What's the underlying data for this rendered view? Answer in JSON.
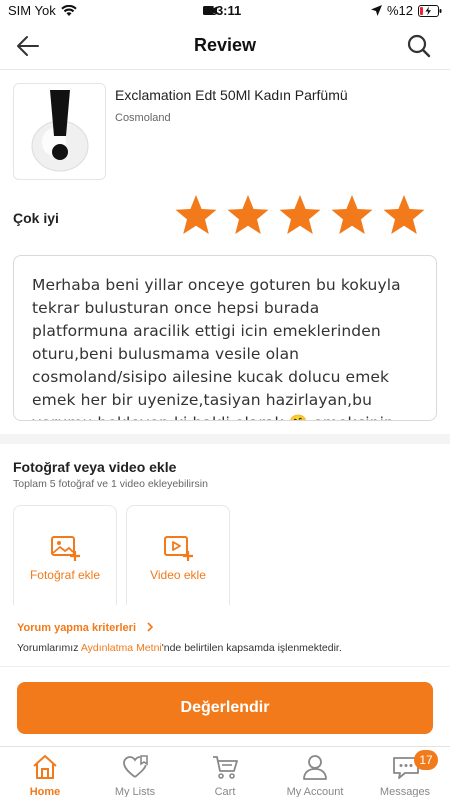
{
  "status_bar": {
    "carrier": "SIM Yok",
    "time": "13:11",
    "battery": "%12"
  },
  "header": {
    "title": "Review"
  },
  "product": {
    "name": "Exclamation Edt 50Ml Kadın Parfümü",
    "brand": "Cosmoland"
  },
  "rating": {
    "label": "Çok iyi",
    "stars": 5,
    "max": 5,
    "color": "#f27a1a"
  },
  "review": {
    "text": "Merhaba beni yillar onceye goturen bu kokuyla tekrar bulusturan once hepsi burada platformuna aracilik ettigi icin emeklerinden oturu,beni bulusmama vesile olan cosmoland/sisipo ailesine kucak dolucu emek emek her bir uyenize,tasiyan hazirlayan,bu yorumu bekleyen ki hakli olarak 🤗 emekcinin teri kurumadan vermek lazim hakkini"
  },
  "media": {
    "title": "Fotoğraf veya video ekle",
    "subtitle": "Toplam 5 fotoğraf ve 1 video ekleyebilirsin",
    "photo_label": "Fotoğraf ekle",
    "video_label": "Video ekle"
  },
  "criteria": {
    "link_label": "Yorum yapma kriterleri",
    "legal_prefix": "Yorumlarımız ",
    "legal_link": "Aydınlatma Metni",
    "legal_suffix": "'nde belirtilen kapsamda işlenmektedir."
  },
  "submit": {
    "label": "Değerlendir"
  },
  "tabbar": {
    "home": "Home",
    "lists": "My Lists",
    "cart": "Cart",
    "account": "My Account",
    "messages": "Messages",
    "messages_badge": "17"
  },
  "colors": {
    "accent": "#f27a1a"
  }
}
